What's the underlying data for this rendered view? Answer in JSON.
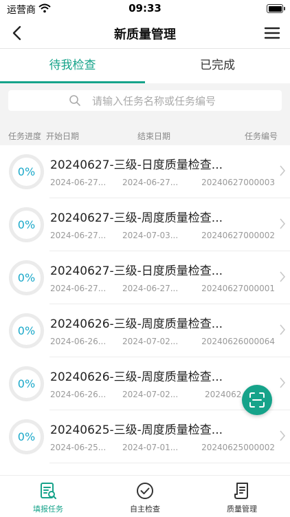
{
  "status_bar": {
    "carrier": "运营商",
    "time": "09:33"
  },
  "header": {
    "title": "新质量管理"
  },
  "tabs": [
    {
      "label": "待我检查",
      "active": true
    },
    {
      "label": "已完成",
      "active": false
    }
  ],
  "search": {
    "placeholder": "请输入任务名称或任务编号"
  },
  "list_header": {
    "progress": "任务进度",
    "start": "开始日期",
    "end": "结束日期",
    "code": "任务编号"
  },
  "tasks": [
    {
      "progress": "0%",
      "title": "20240627-三级-日度质量检查...",
      "start": "2024-06-27...",
      "end": "2024-06-27...",
      "code": "20240627000003"
    },
    {
      "progress": "0%",
      "title": "20240627-三级-周度质量检查...",
      "start": "2024-06-27...",
      "end": "2024-07-03...",
      "code": "20240627000002"
    },
    {
      "progress": "0%",
      "title": "20240627-三级-日度质量检查...",
      "start": "2024-06-27...",
      "end": "2024-06-27...",
      "code": "20240627000001"
    },
    {
      "progress": "0%",
      "title": "20240626-三级-周度质量检查...",
      "start": "2024-06-26...",
      "end": "2024-07-02...",
      "code": "20240626000064"
    },
    {
      "progress": "0%",
      "title": "20240626-三级-周度质量检查...",
      "start": "2024-06-26...",
      "end": "2024-07-02...",
      "code": "2024062"
    },
    {
      "progress": "0%",
      "title": "20240625-三级-周度质量检查...",
      "start": "2024-06-25...",
      "end": "2024-07-01...",
      "code": "20240625000002"
    }
  ],
  "bottom_tabs": [
    {
      "label": "填报任务",
      "icon": "report-task-icon",
      "active": true
    },
    {
      "label": "自主检查",
      "icon": "self-check-icon",
      "active": false
    },
    {
      "label": "质量管理",
      "icon": "quality-manage-icon",
      "active": false
    }
  ],
  "colors": {
    "accent": "#16a38a",
    "progress": "#1aa8c9"
  }
}
